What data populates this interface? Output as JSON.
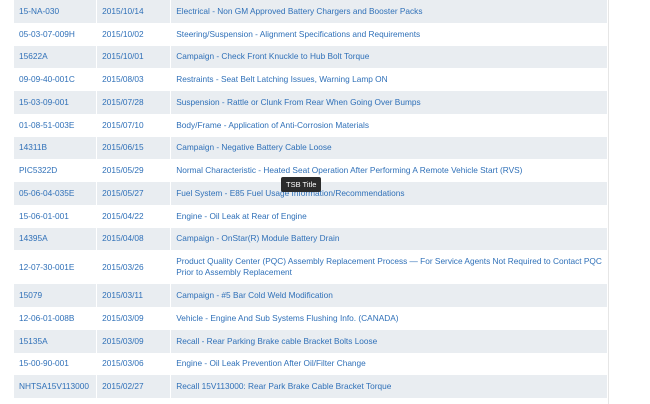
{
  "tooltip": "TSB Title",
  "rows": [
    {
      "id": "15-NA-030",
      "date": "2015/10/14",
      "title": "Electrical - Non GM Approved Battery Chargers and Booster Packs"
    },
    {
      "id": "05-03-07-009H",
      "date": "2015/10/02",
      "title": "Steering/Suspension - Alignment Specifications and Requirements"
    },
    {
      "id": "15622A",
      "date": "2015/10/01",
      "title": "Campaign - Check Front Knuckle to Hub Bolt Torque"
    },
    {
      "id": "09-09-40-001C",
      "date": "2015/08/03",
      "title": "Restraints - Seat Belt Latching Issues, Warning Lamp ON"
    },
    {
      "id": "15-03-09-001",
      "date": "2015/07/28",
      "title": "Suspension - Rattle or Clunk From Rear When Going Over Bumps"
    },
    {
      "id": "01-08-51-003E",
      "date": "2015/07/10",
      "title": "Body/Frame - Application of Anti-Corrosion Materials"
    },
    {
      "id": "14311B",
      "date": "2015/06/15",
      "title": "Campaign - Negative Battery Cable Loose"
    },
    {
      "id": "PIC5322D",
      "date": "2015/05/29",
      "title": "Normal Characteristic - Heated Seat Operation After Performing A Remote Vehicle Start (RVS)"
    },
    {
      "id": "05-06-04-035E",
      "date": "2015/05/27",
      "title": "Fuel System - E85 Fuel Usage Information/Recommendations"
    },
    {
      "id": "15-06-01-001",
      "date": "2015/04/22",
      "title": "Engine - Oil Leak at Rear of Engine"
    },
    {
      "id": "14395A",
      "date": "2015/04/08",
      "title": "Campaign - OnStar(R) Module Battery Drain"
    },
    {
      "id": "12-07-30-001E",
      "date": "2015/03/26",
      "title": "Product Quality Center (PQC) Assembly Replacement Process — For Service Agents Not Required to Contact PQC Prior to Assembly Replacement"
    },
    {
      "id": "15079",
      "date": "2015/03/11",
      "title": "Campaign - #5 Bar Cold Weld Modification"
    },
    {
      "id": "12-06-01-008B",
      "date": "2015/03/09",
      "title": "Vehicle - Engine And Sub Systems Flushing Info. (CANADA)"
    },
    {
      "id": "15135A",
      "date": "2015/03/09",
      "title": "Recall - Rear Parking Brake cable Bracket Bolts Loose"
    },
    {
      "id": "15-00-90-001",
      "date": "2015/03/06",
      "title": "Engine - Oil Leak Prevention After Oil/Filter Change"
    },
    {
      "id": "NHTSA15V113000",
      "date": "2015/02/27",
      "title": "Recall 15V113000: Rear Park Brake Cable Bracket Torque"
    }
  ]
}
